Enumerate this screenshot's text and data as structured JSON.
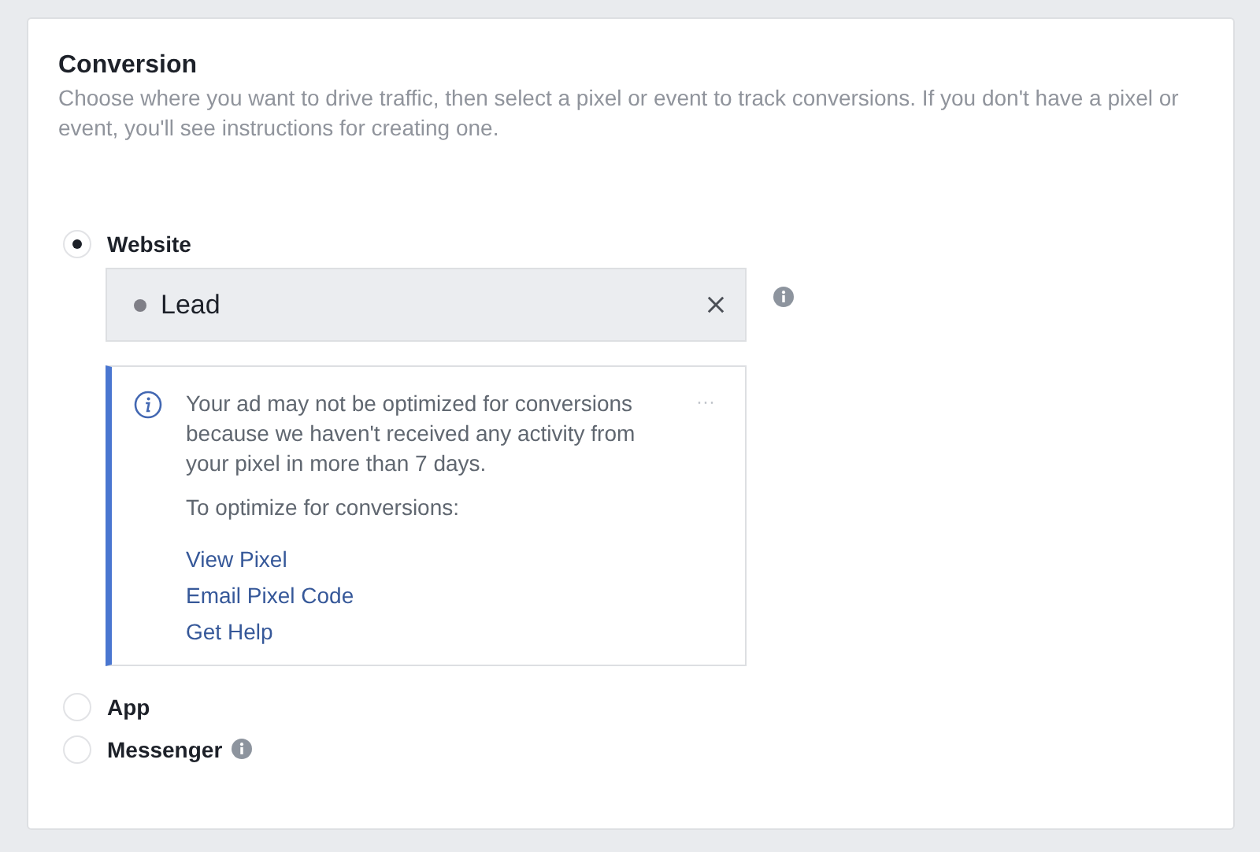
{
  "section": {
    "title": "Conversion",
    "description": "Choose where you want to drive traffic, then select a pixel or event to track conversions. If you don't have a pixel or event, you'll see instructions for creating one."
  },
  "options": [
    {
      "label": "Website",
      "selected": true,
      "info": false,
      "event": {
        "value": "Lead"
      },
      "notice": {
        "message": "Your ad may not be optimized for conversions because we haven't received any activity from your pixel in more than 7 days.",
        "more": "···",
        "prompt": "To optimize for conversions:",
        "links": [
          "View Pixel",
          "Email Pixel Code",
          "Get Help"
        ]
      }
    },
    {
      "label": "App",
      "selected": false,
      "info": false
    },
    {
      "label": "Messenger",
      "selected": false,
      "info": true
    }
  ]
}
